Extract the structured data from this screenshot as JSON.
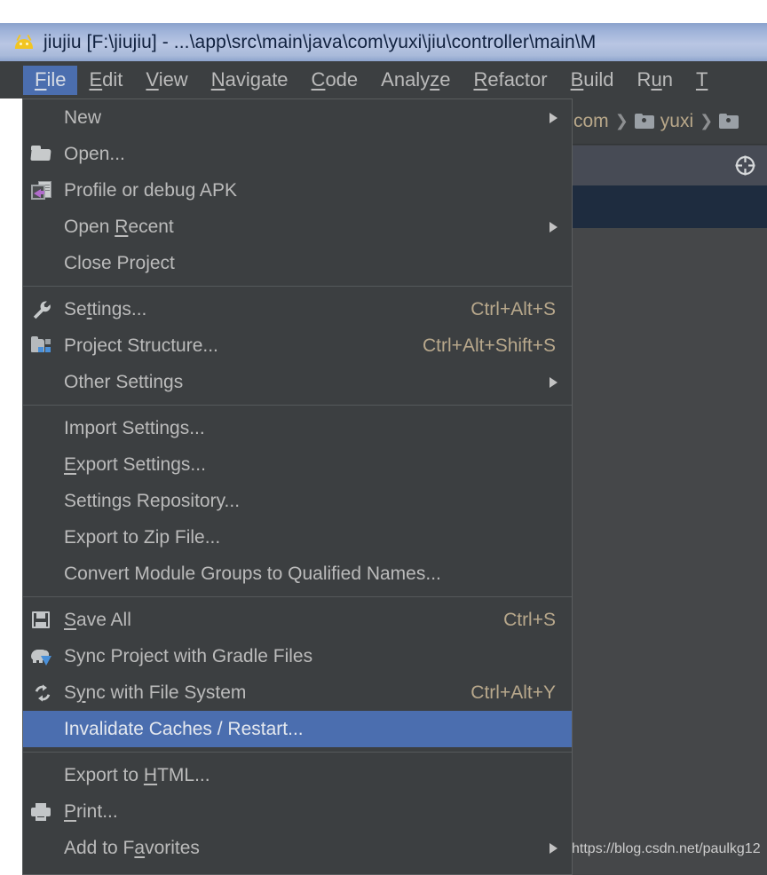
{
  "window": {
    "title": "jiujiu [F:\\jiujiu] - ...\\app\\src\\main\\java\\com\\yuxi\\jiu\\controller\\main\\M",
    "app_icon": "android-icon",
    "titlebar_color": "#a9bada",
    "accent_color": "#4b6eaf"
  },
  "menubar": {
    "items": [
      {
        "label": "File",
        "mnemonic": "F",
        "active": true
      },
      {
        "label": "Edit",
        "mnemonic": "E",
        "active": false
      },
      {
        "label": "View",
        "mnemonic": "V",
        "active": false
      },
      {
        "label": "Navigate",
        "mnemonic": "N",
        "active": false
      },
      {
        "label": "Code",
        "mnemonic": "C",
        "active": false
      },
      {
        "label": "Analyze",
        "mnemonic": "z",
        "active": false
      },
      {
        "label": "Refactor",
        "mnemonic": "R",
        "active": false
      },
      {
        "label": "Build",
        "mnemonic": "B",
        "active": false
      },
      {
        "label": "Run",
        "mnemonic": "u",
        "active": false
      },
      {
        "label": "T",
        "mnemonic": "T",
        "active": false
      }
    ]
  },
  "file_menu": {
    "sections": [
      {
        "items": [
          {
            "label": "New",
            "icon": null,
            "shortcut": "",
            "submenu": true,
            "selected": false
          },
          {
            "label": "Open...",
            "icon": "folder-open-icon",
            "shortcut": "",
            "submenu": false,
            "selected": false
          },
          {
            "label": "Profile or debug APK",
            "icon": "profile-apk-icon",
            "shortcut": "",
            "submenu": false,
            "selected": false
          },
          {
            "label": "Open Recent",
            "icon": null,
            "shortcut": "",
            "submenu": true,
            "selected": false,
            "mnemonic": "R"
          },
          {
            "label": "Close Project",
            "icon": null,
            "shortcut": "",
            "submenu": false,
            "selected": false
          }
        ]
      },
      {
        "items": [
          {
            "label": "Settings...",
            "icon": "wrench-icon",
            "shortcut": "Ctrl+Alt+S",
            "submenu": false,
            "selected": false,
            "mnemonic": "t"
          },
          {
            "label": "Project Structure...",
            "icon": "project-structure-icon",
            "shortcut": "Ctrl+Alt+Shift+S",
            "submenu": false,
            "selected": false
          },
          {
            "label": "Other Settings",
            "icon": null,
            "shortcut": "",
            "submenu": true,
            "selected": false
          }
        ]
      },
      {
        "items": [
          {
            "label": "Import Settings...",
            "icon": null,
            "shortcut": "",
            "submenu": false,
            "selected": false
          },
          {
            "label": "Export Settings...",
            "icon": null,
            "shortcut": "",
            "submenu": false,
            "selected": false,
            "mnemonic": "E"
          },
          {
            "label": "Settings Repository...",
            "icon": null,
            "shortcut": "",
            "submenu": false,
            "selected": false
          },
          {
            "label": "Export to Zip File...",
            "icon": null,
            "shortcut": "",
            "submenu": false,
            "selected": false
          },
          {
            "label": "Convert Module Groups to Qualified Names...",
            "icon": null,
            "shortcut": "",
            "submenu": false,
            "selected": false
          }
        ]
      },
      {
        "items": [
          {
            "label": "Save All",
            "icon": "save-icon",
            "shortcut": "Ctrl+S",
            "submenu": false,
            "selected": false,
            "mnemonic": "S"
          },
          {
            "label": "Sync Project with Gradle Files",
            "icon": "gradle-icon",
            "shortcut": "",
            "submenu": false,
            "selected": false
          },
          {
            "label": "Sync with File System",
            "icon": "sync-icon",
            "shortcut": "Ctrl+Alt+Y",
            "submenu": false,
            "selected": false,
            "mnemonic": "y"
          },
          {
            "label": "Invalidate Caches / Restart...",
            "icon": null,
            "shortcut": "",
            "submenu": false,
            "selected": true
          }
        ]
      },
      {
        "items": [
          {
            "label": "Export to HTML...",
            "icon": null,
            "shortcut": "",
            "submenu": false,
            "selected": false,
            "mnemonic": "H"
          },
          {
            "label": "Print...",
            "icon": "print-icon",
            "shortcut": "",
            "submenu": false,
            "selected": false,
            "mnemonic": "P"
          },
          {
            "label": "Add to Favorites",
            "icon": null,
            "shortcut": "",
            "submenu": true,
            "selected": false,
            "mnemonic": "a"
          }
        ]
      }
    ]
  },
  "editor_area": {
    "breadcrumb": [
      {
        "label": "com",
        "icon": null
      },
      {
        "label": "yuxi",
        "icon": "folder-icon"
      },
      {
        "label": "",
        "icon": "folder-icon"
      }
    ],
    "toolbar_icon": "crosshair-target-icon"
  },
  "watermark": {
    "text": "https://blog.csdn.net/paulkg12"
  }
}
